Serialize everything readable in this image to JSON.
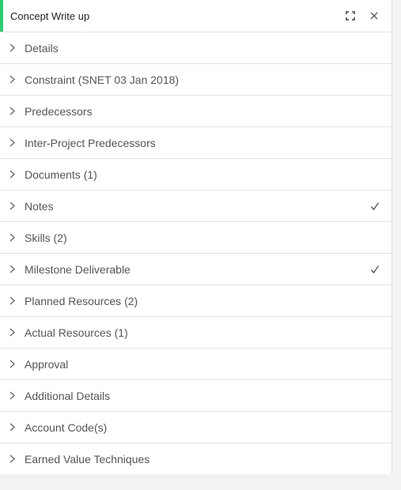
{
  "header": {
    "title": "Concept Write up",
    "accent_color": "#2ecc71",
    "expand_icon": "expand-icon",
    "close_icon": "close-icon"
  },
  "sections": [
    {
      "label": "Details",
      "checked": false
    },
    {
      "label": "Constraint (SNET 03 Jan 2018)",
      "checked": false
    },
    {
      "label": "Predecessors",
      "checked": false
    },
    {
      "label": "Inter-Project Predecessors",
      "checked": false
    },
    {
      "label": "Documents (1)",
      "checked": false
    },
    {
      "label": "Notes",
      "checked": true
    },
    {
      "label": "Skills (2)",
      "checked": false
    },
    {
      "label": "Milestone Deliverable",
      "checked": true
    },
    {
      "label": "Planned Resources (2)",
      "checked": false
    },
    {
      "label": "Actual Resources (1)",
      "checked": false
    },
    {
      "label": "Approval",
      "checked": false
    },
    {
      "label": "Additional Details",
      "checked": false
    },
    {
      "label": "Account Code(s)",
      "checked": false
    },
    {
      "label": "Earned Value Techniques",
      "checked": false
    }
  ]
}
